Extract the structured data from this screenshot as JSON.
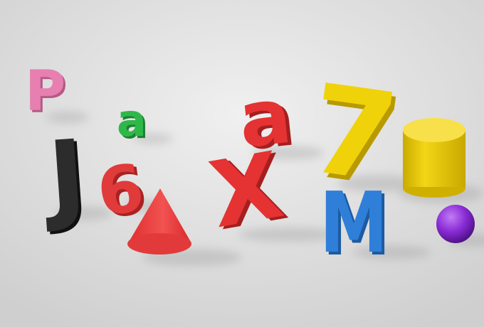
{
  "scene": {
    "background": "#e3e3e3",
    "objects": [
      {
        "kind": "letter",
        "text": "P",
        "color": "#e77fb0"
      },
      {
        "kind": "letter",
        "text": "a",
        "color": "#2fb84a"
      },
      {
        "kind": "letter",
        "text": "J",
        "color": "#262626"
      },
      {
        "kind": "digit",
        "text": "6",
        "color": "#e03a3a"
      },
      {
        "kind": "shape",
        "shape": "cone",
        "color": "#ee3b3b"
      },
      {
        "kind": "letter",
        "text": "a",
        "color": "#e53232"
      },
      {
        "kind": "letter",
        "text": "X",
        "color": "#e53232"
      },
      {
        "kind": "digit",
        "text": "7",
        "color": "#f0d20a"
      },
      {
        "kind": "letter",
        "text": "M",
        "color": "#2f7fd8"
      },
      {
        "kind": "shape",
        "shape": "cylinder",
        "color": "#f2d312"
      },
      {
        "kind": "shape",
        "shape": "sphere",
        "color": "#8a2bd6"
      }
    ]
  }
}
